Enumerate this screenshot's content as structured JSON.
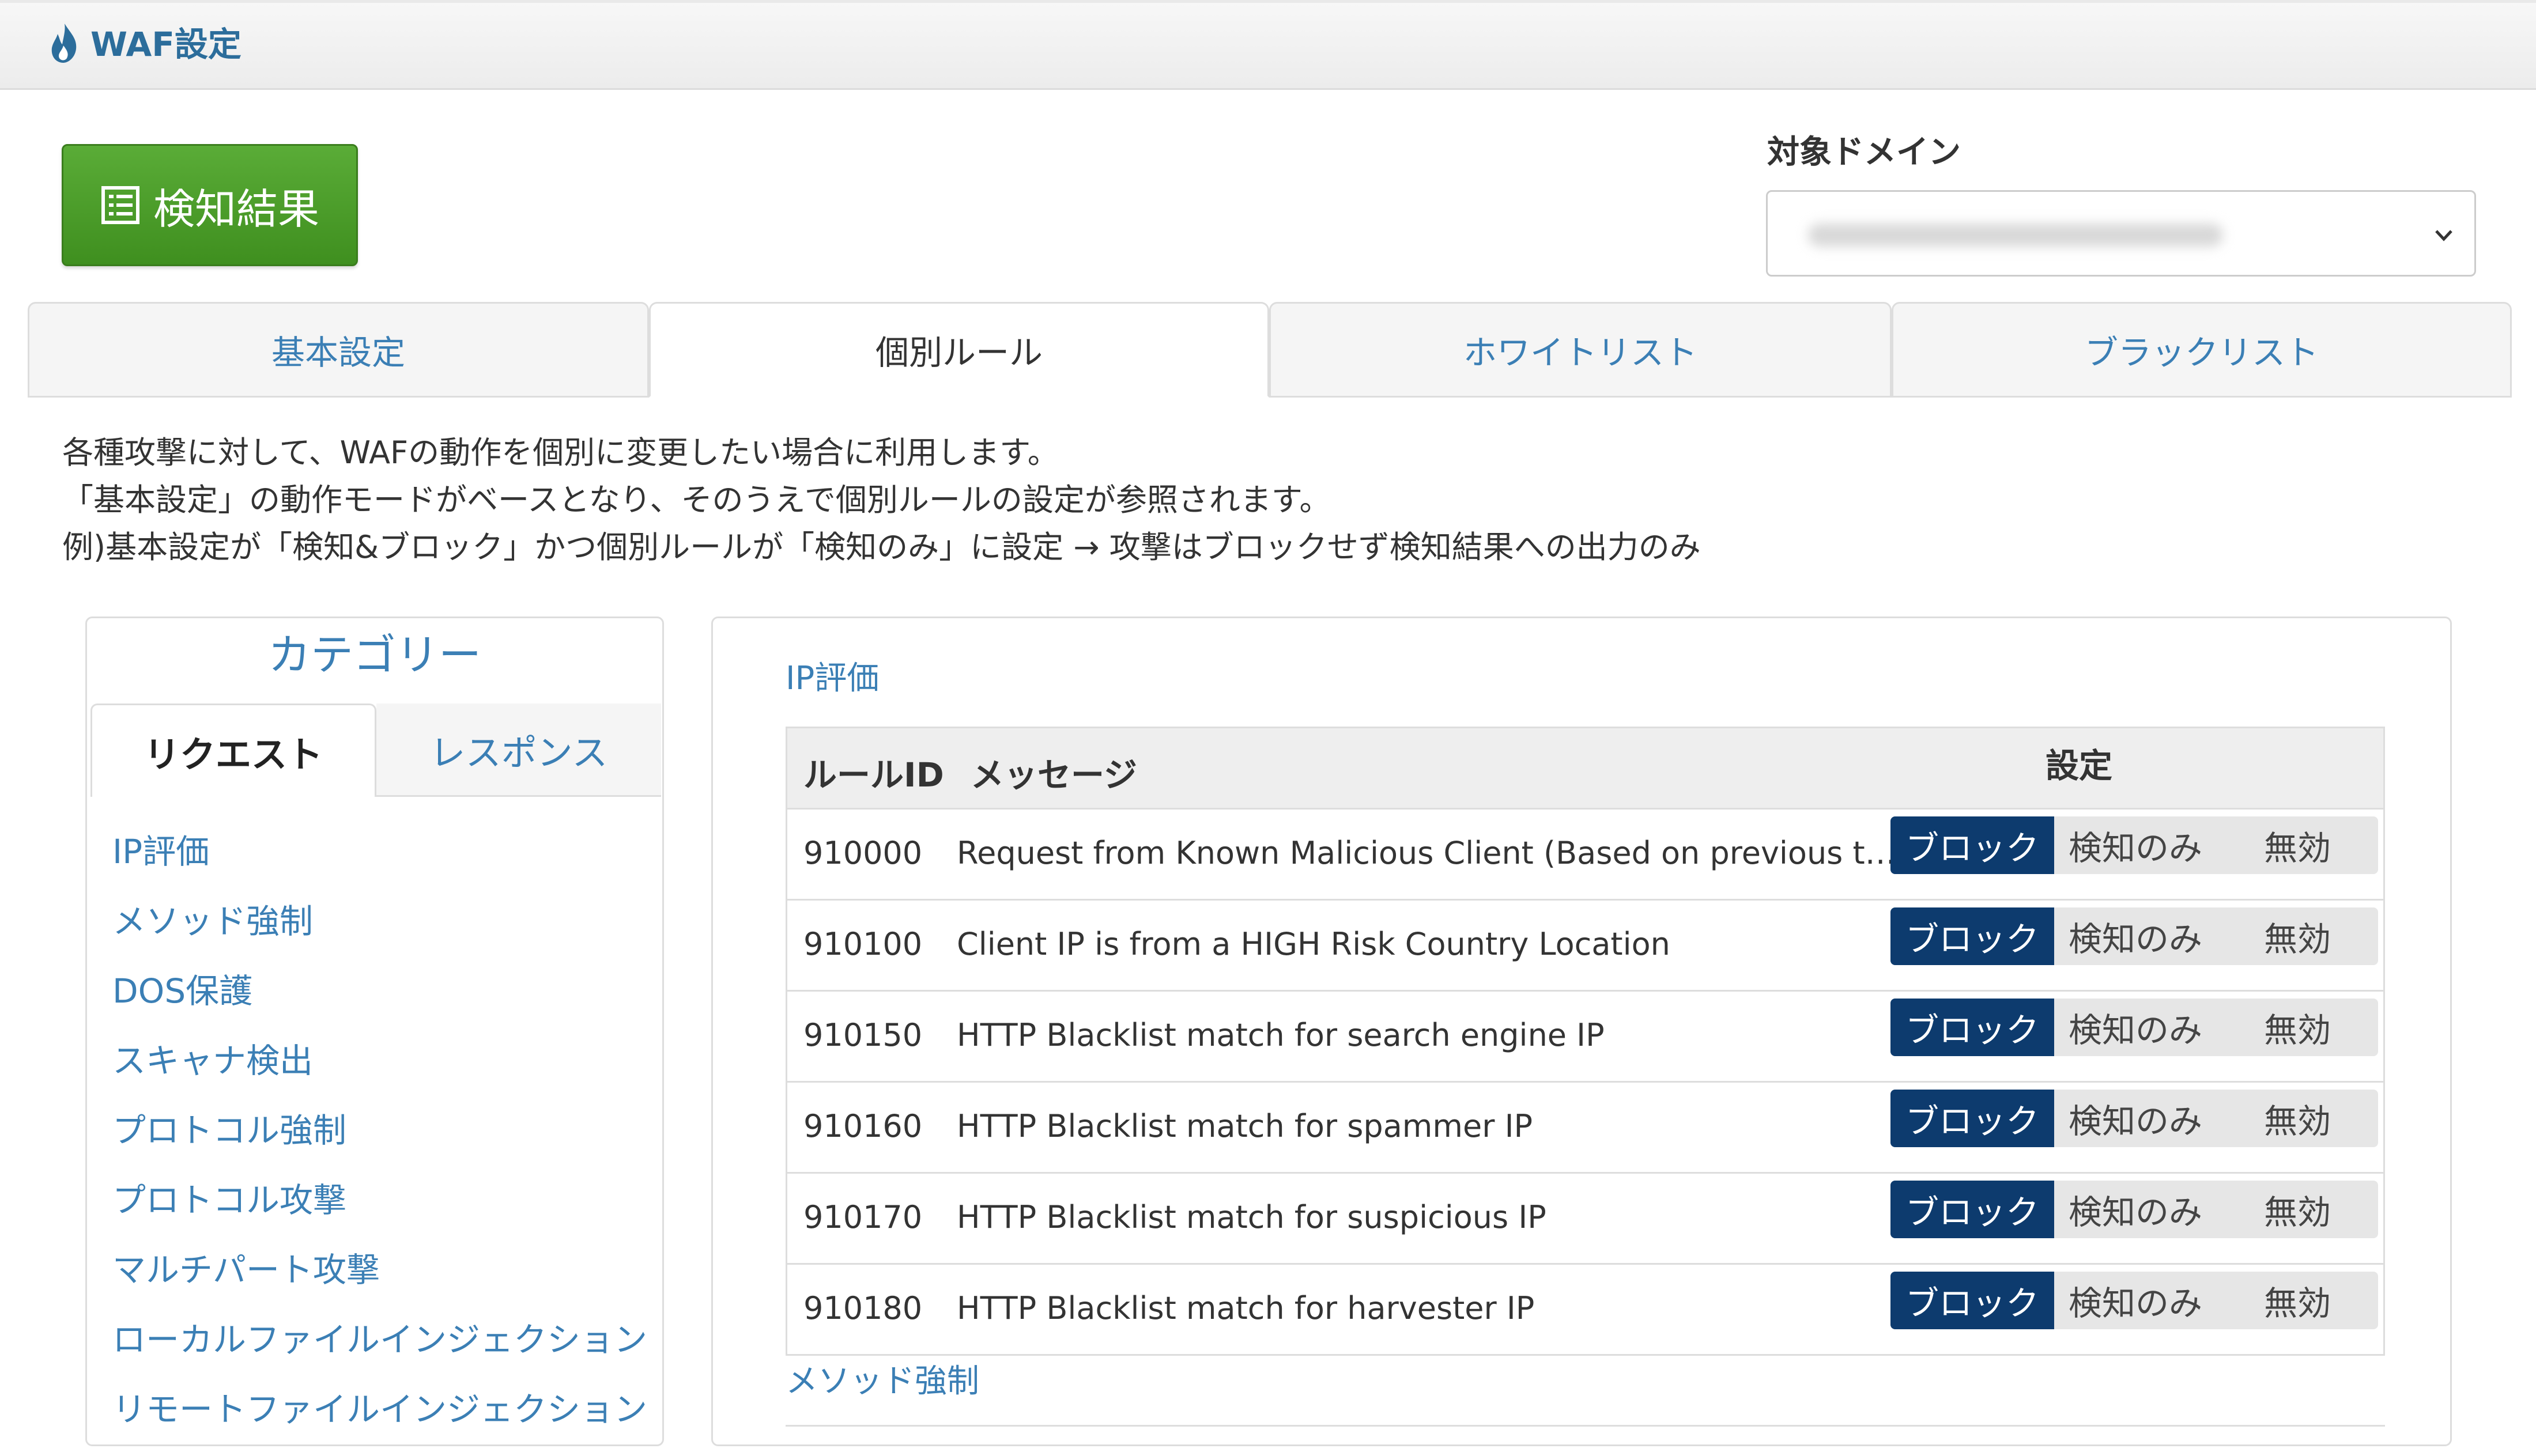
{
  "header": {
    "title": "WAF設定",
    "icon": "flame-icon"
  },
  "result_button": {
    "label": "検知結果",
    "icon": "list-icon"
  },
  "domain": {
    "label": "対象ドメイン",
    "value_blurred": true
  },
  "tabs": [
    {
      "label": "基本設定",
      "active": false
    },
    {
      "label": "個別ルール",
      "active": true
    },
    {
      "label": "ホワイトリスト",
      "active": false
    },
    {
      "label": "ブラックリスト",
      "active": false
    }
  ],
  "description": [
    "各種攻撃に対して、WAFの動作を個別に変更したい場合に利用します。",
    "「基本設定」の動作モードがベースとなり、そのうえで個別ルールの設定が参照されます。",
    "例)基本設定が「検知&ブロック」かつ個別ルールが「検知のみ」に設定 → 攻撃はブロックせず検知結果への出力のみ"
  ],
  "category": {
    "title": "カテゴリー",
    "tabs": [
      {
        "label": "リクエスト",
        "active": true
      },
      {
        "label": "レスポンス",
        "active": false
      }
    ],
    "items": [
      "IP評価",
      "メソッド強制",
      "DOS保護",
      "スキャナ検出",
      "プロトコル強制",
      "プロトコル攻撃",
      "マルチパート攻撃",
      "ローカルファイルインジェクション",
      "リモートファイルインジェクション"
    ]
  },
  "rules": {
    "section_title": "IP評価",
    "next_section_title": "メソッド強制",
    "headers": {
      "id": "ルールID",
      "message": "メッセージ",
      "setting": "設定"
    },
    "options": [
      "ブロック",
      "検知のみ",
      "無効"
    ],
    "rows": [
      {
        "id": "910000",
        "message": "Request from Known Malicious Client (Based on previous tra…",
        "selected": "ブロック"
      },
      {
        "id": "910100",
        "message": "Client IP is from a HIGH Risk Country Location",
        "selected": "ブロック"
      },
      {
        "id": "910150",
        "message": "HTTP Blacklist match for search engine IP",
        "selected": "ブロック"
      },
      {
        "id": "910160",
        "message": "HTTP Blacklist match for spammer IP",
        "selected": "ブロック"
      },
      {
        "id": "910170",
        "message": "HTTP Blacklist match for suspicious IP",
        "selected": "ブロック"
      },
      {
        "id": "910180",
        "message": "HTTP Blacklist match for harvester IP",
        "selected": "ブロック"
      }
    ]
  },
  "colors": {
    "accent_blue": "#3b7fb5",
    "selected_dark": "#0d3b6e",
    "button_green": "#4c9e2b"
  }
}
